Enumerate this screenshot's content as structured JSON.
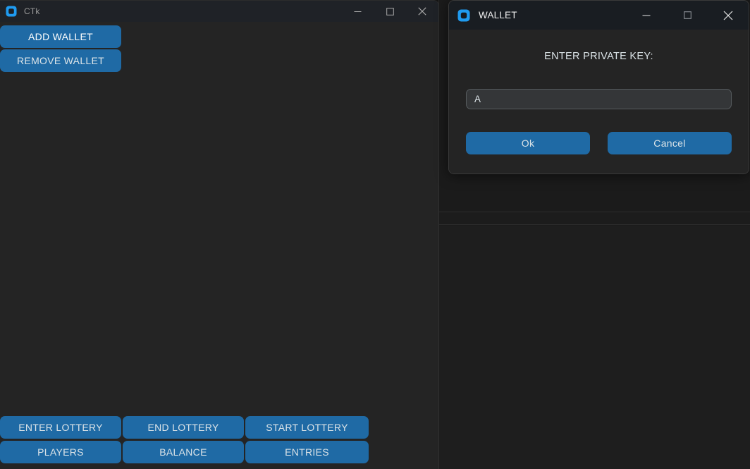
{
  "desktop": {
    "background_color": "#151515",
    "background_window_color": "#1b1b1b"
  },
  "theme": {
    "accent": "#1f6aa5",
    "window_bg": "#242424",
    "entry_bg": "#343638",
    "text": "#dce4e8",
    "text_bright": "#ffffff",
    "titlebar_inactive": "#1f2227",
    "titlebar_active": "#191d22"
  },
  "main_window": {
    "icon": "ctk-app-icon",
    "title": "CTk",
    "active": false,
    "caption": {
      "minimize": "minimize-icon",
      "maximize": "maximize-icon",
      "close": "close-icon"
    },
    "top_buttons": [
      {
        "id": "add-wallet",
        "label": "ADD WALLET",
        "state": "hovered"
      },
      {
        "id": "remove-wallet",
        "label": "REMOVE WALLET",
        "state": "normal"
      }
    ],
    "bottom_buttons": [
      {
        "id": "enter-lottery",
        "label": "ENTER LOTTERY"
      },
      {
        "id": "end-lottery",
        "label": "END LOTTERY"
      },
      {
        "id": "start-lottery",
        "label": "START LOTTERY"
      },
      {
        "id": "players",
        "label": "PLAYERS"
      },
      {
        "id": "balance",
        "label": "BALANCE"
      },
      {
        "id": "entries",
        "label": "ENTRIES"
      }
    ]
  },
  "dialog": {
    "icon": "ctk-app-icon",
    "title": "WALLET",
    "active": true,
    "caption": {
      "minimize": "minimize-icon",
      "maximize": "maximize-icon",
      "close": "close-icon"
    },
    "prompt": "ENTER PRIVATE KEY:",
    "input": {
      "value": "A",
      "placeholder": ""
    },
    "buttons": {
      "ok": "Ok",
      "cancel": "Cancel"
    }
  }
}
